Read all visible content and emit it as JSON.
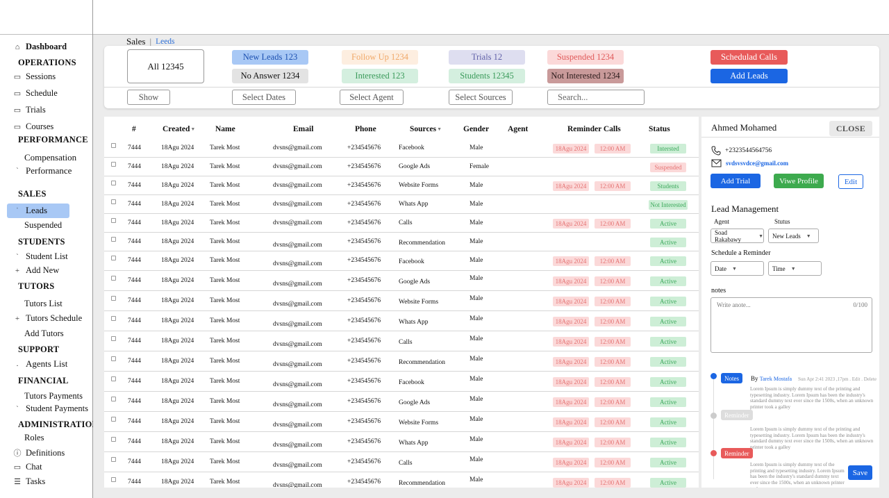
{
  "breadcrumb": {
    "section": "Sales",
    "separator": "|",
    "current": "Leeds"
  },
  "sidebar": {
    "dashboard": "Dashboard",
    "operations_head": "OPERATIONS",
    "sessions": "Sessions",
    "schedule": "Schedule",
    "trials": "Trials",
    "courses": "Courses",
    "performance_head": "PERFORMANCE",
    "compensation": "Compensation",
    "performance": "Performance",
    "sales_head": "SALES",
    "leads": "Leads",
    "suspended": "Suspended",
    "students_head": "STUDENTS",
    "student_list": "Student List",
    "add_new": "Add New",
    "tutors_head": "TUTORS",
    "tutors_list": "Tutors List",
    "tutors_schedule": "Tutors Schedule",
    "add_tutors": "Add Tutors",
    "support_head": "SUPPORT",
    "agents_list": "Agents List",
    "financial_head": "FINANCIAL",
    "tutors_payments": "Tutors Payments",
    "student_payments": "Student Payments",
    "admin_head": "ADMINISTRATION",
    "roles": "Roles",
    "definitions": "Definitions",
    "chat": "Chat",
    "tasks": "Tasks"
  },
  "filters": {
    "all": "All 12345",
    "new_leads": "New Leads  123",
    "no_answer": "No Answer  1234",
    "follow_up": "Follow Up  1234",
    "interested": "Interested  123",
    "trials": "Trials  12",
    "students": "Students  12345",
    "suspended": "Suspended  1234",
    "not_interested": "Not Interested 1234",
    "scheduled_calls": "Schedulad Calls",
    "add_leads": "Add Leads",
    "show": "Show",
    "select_dates": "Select Dates",
    "select_agent": "Select Agent",
    "select_sources": "Select Sources",
    "search_placeholder": "Search..."
  },
  "table": {
    "headers": [
      "#",
      "Created",
      "Name",
      "Email",
      "Phone",
      "Sources",
      "Gender",
      "Agent",
      "Reminder Calls",
      "Status"
    ],
    "rows": [
      {
        "id": "7444",
        "created": "18Agu 2024",
        "name": "Tarek Most",
        "email": "dvsns@gmail.com",
        "phone": "+234545676",
        "source": "Facebook",
        "gender": "Male",
        "rdate": "18Agu 2024",
        "rtime": "12:00 AM",
        "status": "Intersted",
        "skind": "green"
      },
      {
        "id": "7444",
        "created": "18Agu 2024",
        "name": "Tarek Most",
        "email": "dvsns@gmail.com",
        "phone": "+234545676",
        "source": "Google Ads",
        "gender": "Female",
        "rdate": "",
        "rtime": "",
        "status": "Suspended",
        "skind": "red"
      },
      {
        "id": "7444",
        "created": "18Agu 2024",
        "name": "Tarek Most",
        "email": "dvsns@gmail.com",
        "phone": "+234545676",
        "source": "Website Forms",
        "gender": "Male",
        "rdate": "18Agu 2024",
        "rtime": "12:00 AM",
        "status": "Students",
        "skind": "green"
      },
      {
        "id": "7444",
        "created": "18Agu 2024",
        "name": "Tarek Most",
        "email": "dvsns@gmail.com",
        "phone": "+234545676",
        "source": "Whats App",
        "gender": "Male",
        "rdate": "",
        "rtime": "",
        "status": "Not Interested",
        "skind": "green"
      },
      {
        "id": "7444",
        "created": "18Agu 2024",
        "name": "Tarek Most",
        "email": "dvsns@gmail.com",
        "phone": "+234545676",
        "source": "Calls",
        "gender": "Male",
        "rdate": "18Agu 2024",
        "rtime": "12:00 AM",
        "status": "Active",
        "skind": "green"
      },
      {
        "id": "7444",
        "created": "18Agu 2024",
        "name": "Tarek Most",
        "email": "dvsns@gmail.com",
        "phone": "+234545676",
        "source": "Recommendation",
        "gender": "Male",
        "rdate": "",
        "rtime": "",
        "status": "Active",
        "skind": "green"
      },
      {
        "id": "7444",
        "created": "18Agu 2024",
        "name": "Tarek Most",
        "email": "dvsns@gmail.com",
        "phone": "+234545676",
        "source": "Facebook",
        "gender": "Male",
        "rdate": "18Agu 2024",
        "rtime": "12:00 AM",
        "status": "Active",
        "skind": "green"
      },
      {
        "id": "7444",
        "created": "18Agu 2024",
        "name": "Tarek Most",
        "email": "dvsns@gmail.com",
        "phone": "+234545676",
        "source": "Google Ads",
        "gender": "Male",
        "rdate": "18Agu 2024",
        "rtime": "12:00 AM",
        "status": "Active",
        "skind": "green"
      },
      {
        "id": "7444",
        "created": "18Agu 2024",
        "name": "Tarek Most",
        "email": "dvsns@gmail.com",
        "phone": "+234545676",
        "source": "Website Forms",
        "gender": "Male",
        "rdate": "18Agu 2024",
        "rtime": "12:00 AM",
        "status": "Active",
        "skind": "green"
      },
      {
        "id": "7444",
        "created": "18Agu 2024",
        "name": "Tarek Most",
        "email": "dvsns@gmail.com",
        "phone": "+234545676",
        "source": "Whats App",
        "gender": "Male",
        "rdate": "18Agu 2024",
        "rtime": "12:00 AM",
        "status": "Active",
        "skind": "green"
      },
      {
        "id": "7444",
        "created": "18Agu 2024",
        "name": "Tarek Most",
        "email": "dvsns@gmail.com",
        "phone": "+234545676",
        "source": "Calls",
        "gender": "Male",
        "rdate": "18Agu 2024",
        "rtime": "12:00 AM",
        "status": "Active",
        "skind": "green"
      },
      {
        "id": "7444",
        "created": "18Agu 2024",
        "name": "Tarek Most",
        "email": "dvsns@gmail.com",
        "phone": "+234545676",
        "source": "Recommendation",
        "gender": "Male",
        "rdate": "18Agu 2024",
        "rtime": "12:00 AM",
        "status": "Active",
        "skind": "green"
      },
      {
        "id": "7444",
        "created": "18Agu 2024",
        "name": "Tarek Most",
        "email": "dvsns@gmail.com",
        "phone": "+234545676",
        "source": "Facebook",
        "gender": "Male",
        "rdate": "18Agu 2024",
        "rtime": "12:00 AM",
        "status": "Active",
        "skind": "green"
      },
      {
        "id": "7444",
        "created": "18Agu 2024",
        "name": "Tarek Most",
        "email": "dvsns@gmail.com",
        "phone": "+234545676",
        "source": "Google Ads",
        "gender": "Male",
        "rdate": "18Agu 2024",
        "rtime": "12:00 AM",
        "status": "Active",
        "skind": "green"
      },
      {
        "id": "7444",
        "created": "18Agu 2024",
        "name": "Tarek Most",
        "email": "dvsns@gmail.com",
        "phone": "+234545676",
        "source": "Website Forms",
        "gender": "Male",
        "rdate": "18Agu 2024",
        "rtime": "12:00 AM",
        "status": "Active",
        "skind": "green"
      },
      {
        "id": "7444",
        "created": "18Agu 2024",
        "name": "Tarek Most",
        "email": "dvsns@gmail.com",
        "phone": "+234545676",
        "source": "Whats App",
        "gender": "Male",
        "rdate": "18Agu 2024",
        "rtime": "12:00 AM",
        "status": "Active",
        "skind": "green"
      },
      {
        "id": "7444",
        "created": "18Agu 2024",
        "name": "Tarek Most",
        "email": "dvsns@gmail.com",
        "phone": "+234545676",
        "source": "Calls",
        "gender": "Male",
        "rdate": "18Agu 2024",
        "rtime": "12:00 AM",
        "status": "Active",
        "skind": "green"
      },
      {
        "id": "7444",
        "created": "18Agu 2024",
        "name": "Tarek Most",
        "email": "dvsns@gmail.com",
        "phone": "+234545676",
        "source": "Recommendation",
        "gender": "Male",
        "rdate": "18Agu 2024",
        "rtime": "12:00 AM",
        "status": "Active",
        "skind": "green"
      }
    ]
  },
  "detail": {
    "name": "Ahmed Mohamed",
    "close": "CLOSE",
    "phone": "+2323544564756",
    "email": "svdsvsvdce@gmail.com",
    "add_trial": "Add Trial",
    "view_profile": "Viwe Profile",
    "edit": "Edit",
    "lead_mgmt": "Lead Management",
    "agent_label": "Agent",
    "status_label": "Stutus",
    "agent_value": "Soad Rakabawy",
    "status_value": "New Leads",
    "reminder_label": "Schedule a Reminder",
    "date": "Date",
    "time": "Time",
    "notes_label": "notes",
    "notes_placeholder": "Write anote...",
    "notes_count": "0/100",
    "timeline": {
      "notes_badge": "Notes",
      "by": "By",
      "author": "Tarek Mostafa",
      "meta": "Sun Apr 2:41 2023 ,17pm . Edit . Delete",
      "lorem": "Lorem Ipsum is simply dummy text of the printing and typesetting industry. Lorem Ipsum has been the industry's standard dummy text ever since the 1500s, when an unknown printer took a galley",
      "lorem_short": "Lorem Ipsum is simply dummy text of the printing and typesetting industry. Lorem Ipsum has been the industry's standard dummy text ever since the 1500s, when an unknown printer took",
      "reminder_badge": "Reminder",
      "reminder_badge2": "Reminder"
    },
    "save": "Save"
  },
  "colors": {
    "accent": "#1b66e3",
    "chip_blue": "#a8c8f5",
    "chip_red": "#e85a5a",
    "chip_green_bg": "#d4efdf",
    "status_green_bg": "#cdeed6",
    "status_green_text": "#3aa85a"
  }
}
